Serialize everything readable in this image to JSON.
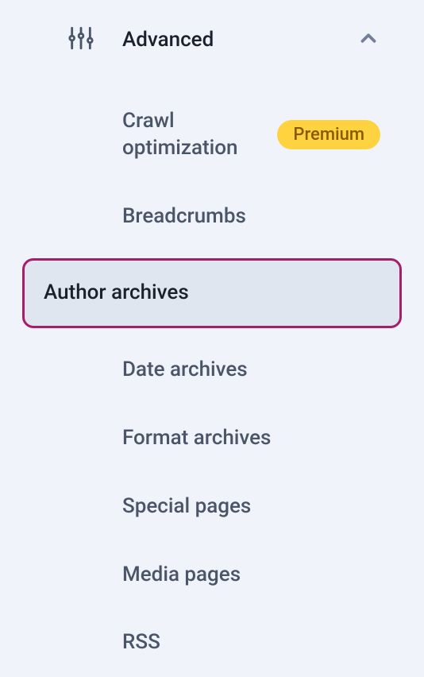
{
  "section": {
    "title": "Advanced",
    "expanded": true
  },
  "items": [
    {
      "label": "Crawl optimization",
      "badge": "Premium",
      "selected": false
    },
    {
      "label": "Breadcrumbs",
      "selected": false
    },
    {
      "label": "Author archives",
      "selected": true
    },
    {
      "label": "Date archives",
      "selected": false
    },
    {
      "label": "Format archives",
      "selected": false
    },
    {
      "label": "Special pages",
      "selected": false
    },
    {
      "label": "Media pages",
      "selected": false
    },
    {
      "label": "RSS",
      "selected": false
    }
  ]
}
